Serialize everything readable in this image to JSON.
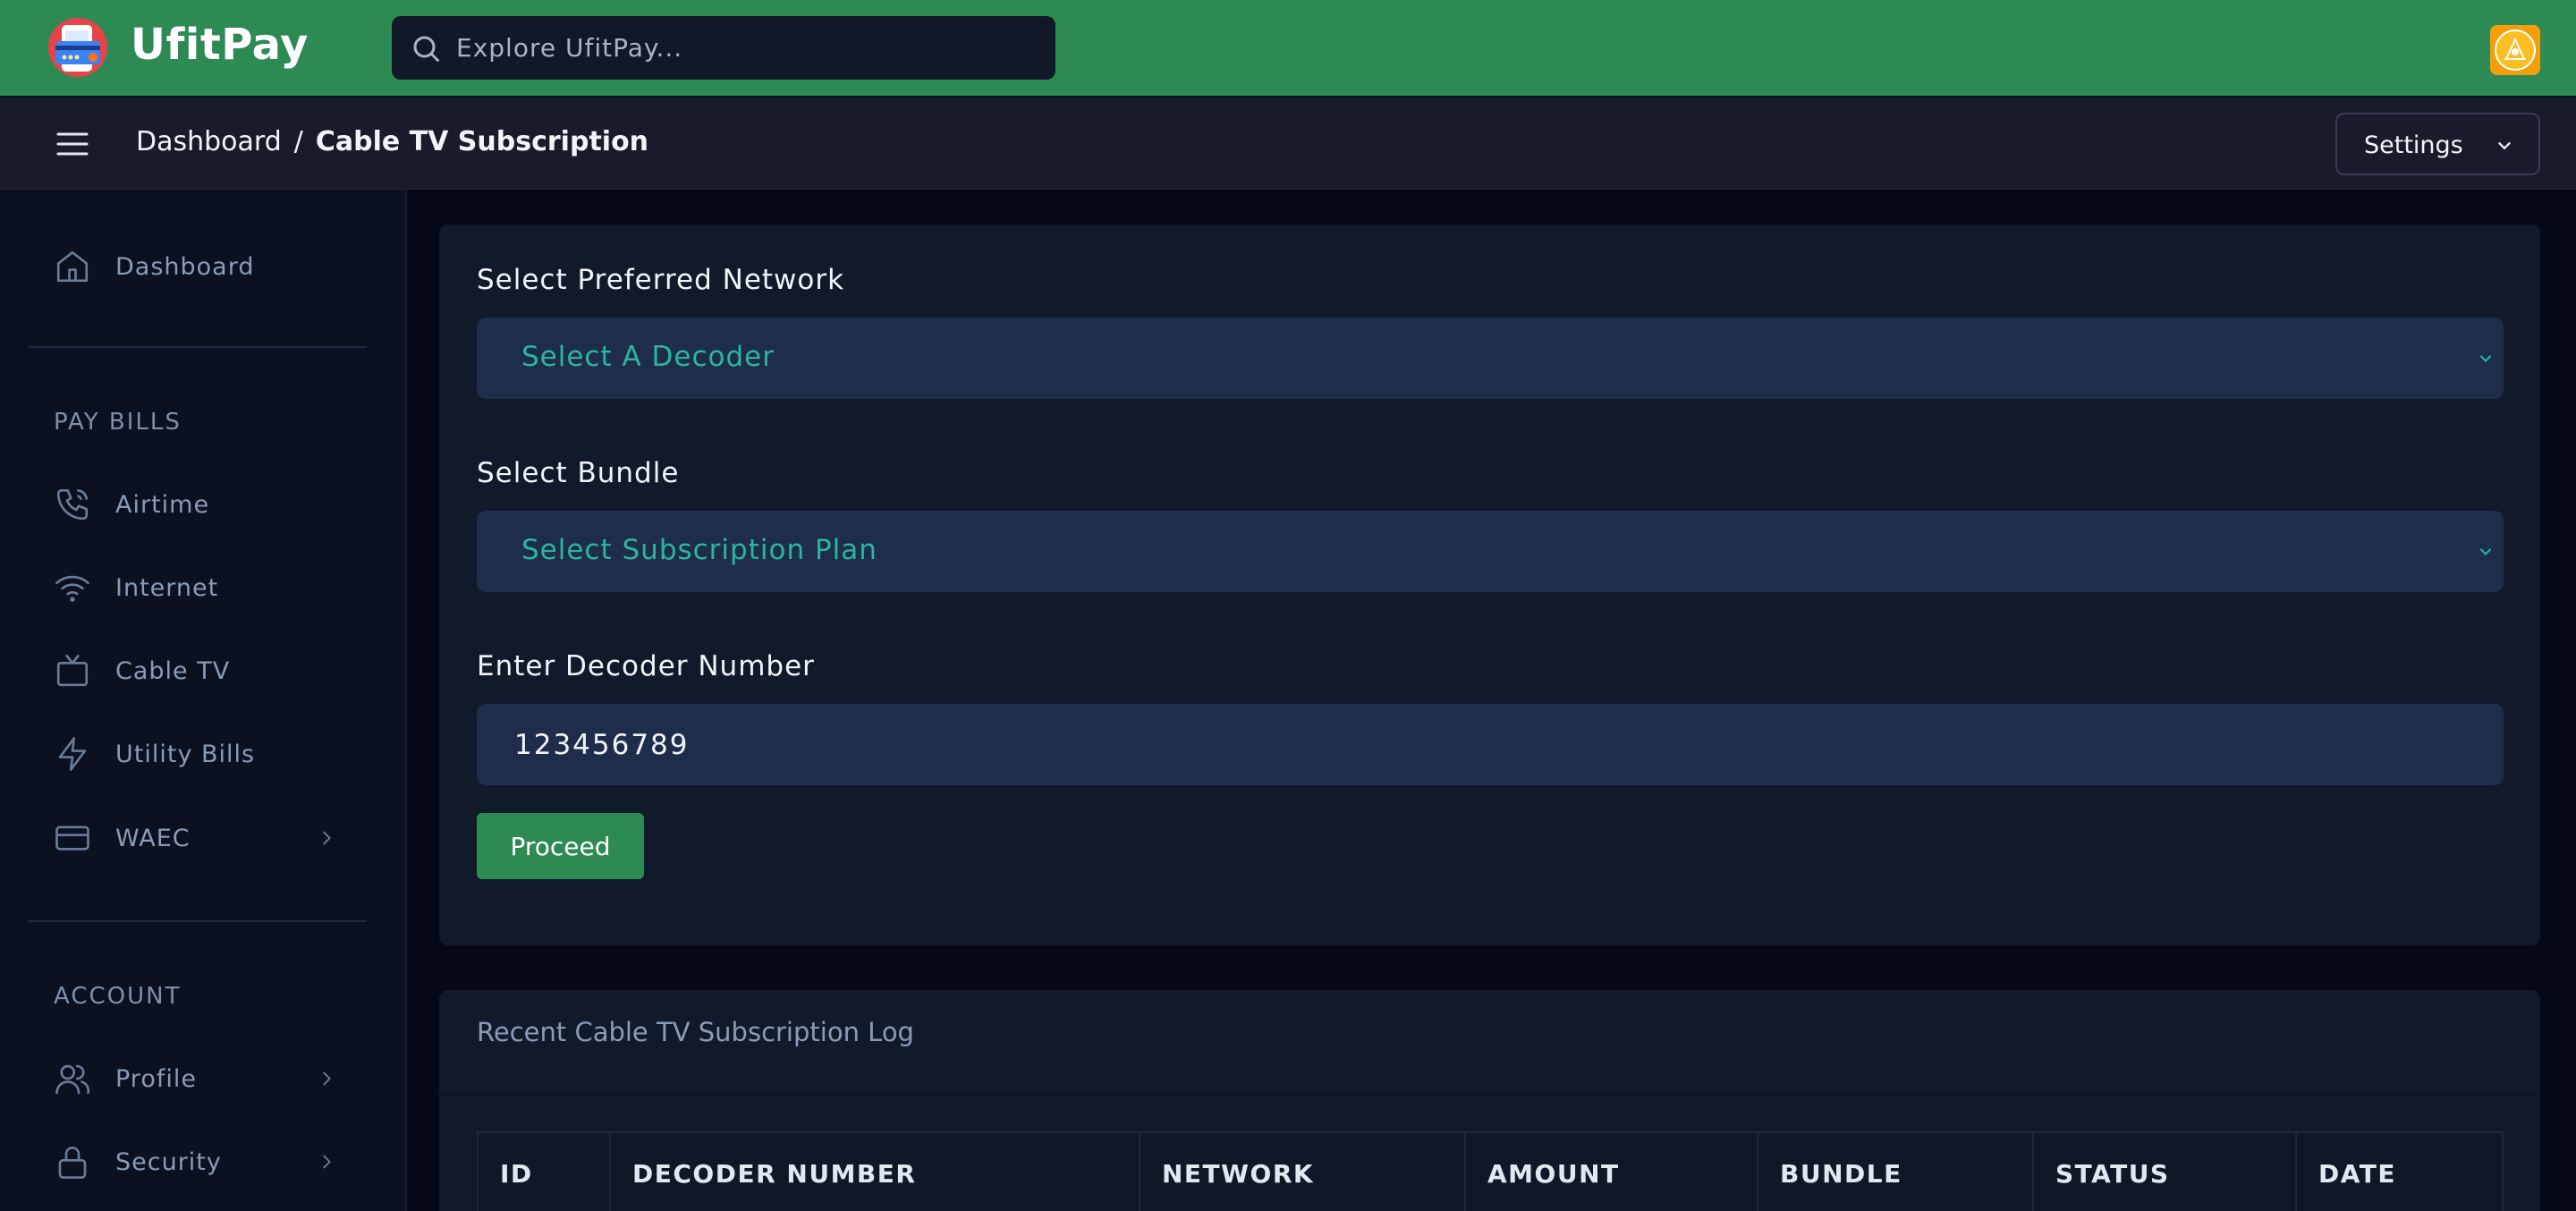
{
  "app": {
    "brand": "UfitPay",
    "search_placeholder": "Explore UfitPay..."
  },
  "header": {
    "breadcrumb": [
      "Dashboard",
      "Cable TV Subscription"
    ],
    "breadcrumb_separator": "/",
    "settings_label": "Settings"
  },
  "sidebar": {
    "top_items": [
      {
        "label": "Dashboard",
        "icon": "home-icon"
      }
    ],
    "pay_bills_title": "PAY BILLS",
    "pay_bills_items": [
      {
        "label": "Airtime",
        "icon": "phone-icon"
      },
      {
        "label": "Internet",
        "icon": "wifi-icon"
      },
      {
        "label": "Cable TV",
        "icon": "tv-icon"
      },
      {
        "label": "Utility Bills",
        "icon": "bolt-icon"
      },
      {
        "label": "WAEC",
        "icon": "card-icon",
        "has_submenu": true
      }
    ],
    "account_title": "ACCOUNT",
    "account_items": [
      {
        "label": "Profile",
        "icon": "users-icon",
        "has_submenu": true
      },
      {
        "label": "Security",
        "icon": "lock-icon",
        "has_submenu": true
      }
    ]
  },
  "form": {
    "network_label": "Select Preferred Network",
    "network_value": "Select A Decoder",
    "bundle_label": "Select Bundle",
    "bundle_value": "Select Subscription Plan",
    "decoder_label": "Enter Decoder Number",
    "decoder_value": "123456789",
    "proceed_label": "Proceed"
  },
  "log": {
    "title": "Recent Cable TV Subscription Log",
    "columns": [
      "ID",
      "DECODER NUMBER",
      "NETWORK",
      "AMOUNT",
      "BUNDLE",
      "STATUS",
      "DATE"
    ]
  },
  "colors": {
    "brand_green": "#2d8a53",
    "accent_teal": "#2bb5a0",
    "panel": "#111a2b",
    "input_bg": "#1e2d4a"
  }
}
